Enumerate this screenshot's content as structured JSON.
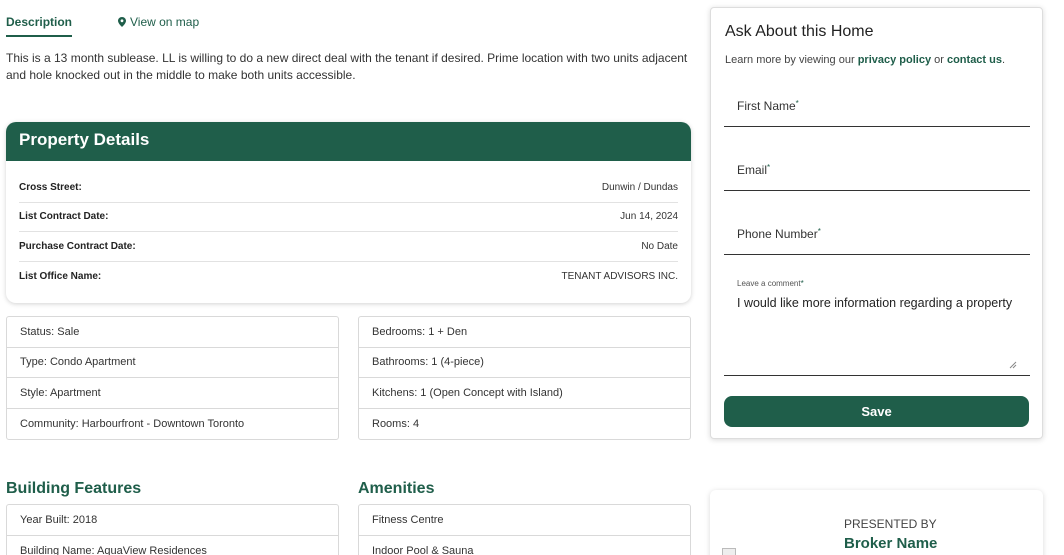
{
  "tabs": {
    "description": "Description",
    "view_on_map": "View on map"
  },
  "description": "This is a 13 month sublease. LL is willing to do a new direct deal with the tenant if desired. Prime location with two units adjacent and hole knocked out in the middle to make both units accessible.",
  "property_details": {
    "title": "Property Details",
    "rows": [
      {
        "label": "Cross Street:",
        "value": "Dunwin / Dundas"
      },
      {
        "label": "List Contract Date:",
        "value": "Jun 14, 2024"
      },
      {
        "label": "Purchase Contract Date:",
        "value": "No Date"
      },
      {
        "label": "List Office Name:",
        "value": "TENANT ADVISORS INC."
      }
    ]
  },
  "info_left": [
    "Status: Sale",
    "Type: Condo Apartment",
    "Style: Apartment",
    "Community: Harbourfront - Downtown Toronto"
  ],
  "info_right": [
    "Bedrooms: 1 + Den",
    "Bathrooms: 1 (4-piece)",
    "Kitchens: 1 (Open Concept with Island)",
    "Rooms: 4"
  ],
  "building_features": {
    "title": "Building Features",
    "items": [
      "Year Built: 2018",
      "Building Name: AquaView Residences"
    ]
  },
  "amenities": {
    "title": "Amenities",
    "items": [
      "Fitness Centre",
      "Indoor Pool & Sauna"
    ]
  },
  "ask": {
    "title": "Ask About this Home",
    "sub_prefix": "Learn more by viewing our ",
    "privacy_link": "privacy policy",
    "sub_or": " or ",
    "contact_link": "contact us",
    "sub_suffix": ".",
    "first_name_label": "First Name",
    "email_label": "Email",
    "phone_label": "Phone Number",
    "required_mark": "*",
    "comment_label": "Leave a comment",
    "comment_value": "I would like more information regarding a property",
    "save_label": "Save"
  },
  "broker": {
    "presented_by": "PRESENTED BY",
    "name": "Broker Name"
  },
  "colors": {
    "brand": "#1f5e4a"
  }
}
